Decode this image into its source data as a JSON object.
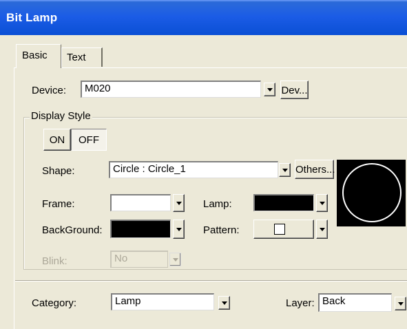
{
  "window": {
    "title": "Bit Lamp"
  },
  "tabs": [
    {
      "label": "Basic"
    },
    {
      "label": "Text"
    }
  ],
  "device": {
    "label": "Device:",
    "value": "M020",
    "dev_button": "Dev..."
  },
  "display_style": {
    "title": "Display Style",
    "on_label": "ON",
    "off_label": "OFF",
    "shape": {
      "label": "Shape:",
      "value": "Circle : Circle_1",
      "others_button": "Others..."
    },
    "frame": {
      "label": "Frame:",
      "color": "#ffffff"
    },
    "lamp": {
      "label": "Lamp:",
      "color": "#000000"
    },
    "background": {
      "label": "BackGround:",
      "color": "#000000"
    },
    "pattern": {
      "label": "Pattern:"
    },
    "blink": {
      "label": "Blink:",
      "value": "No"
    },
    "preview": {
      "shape": "circle",
      "fill": "#000000",
      "frame": "#ffffff"
    }
  },
  "category": {
    "label": "Category:",
    "value": "Lamp"
  },
  "layer": {
    "label": "Layer:",
    "value": "Back"
  },
  "colors": {
    "titlebar": "#0a4fd4",
    "dialog_bg": "#ece9d8"
  }
}
